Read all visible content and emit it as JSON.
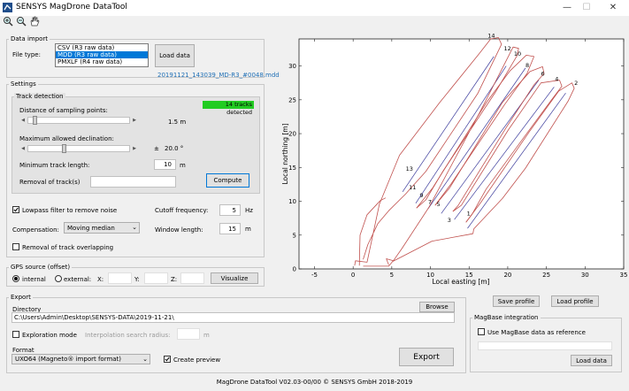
{
  "window": {
    "title": "SENSYS MagDrone DataTool",
    "minimize": "—",
    "maximize": "☐",
    "close": "✕"
  },
  "data_import": {
    "group_label": "Data import",
    "file_type_label": "File type:",
    "file_types": [
      "CSV (R3 raw data)",
      "MDD (R3 raw data)",
      "PMXLF (R4 raw data)"
    ],
    "selected_index": 1,
    "load_button": "Load data",
    "file_name": "20191121_143039_MD-R3_#0048.mdd"
  },
  "settings": {
    "group_label": "Settings",
    "track_detection": {
      "group_label": "Track detection",
      "badge": "14 tracks detected",
      "badge_color": "#22cc22",
      "sampling_label": "Distance of sampling points:",
      "sampling_value": "1.5 m",
      "sampling_level": 0.05,
      "declination_label": "Maximum allowed declination:",
      "declination_pm": "±",
      "declination_value": "20.0 °",
      "declination_level": 0.35,
      "min_length_label": "Minimum track length:",
      "min_length_value": "10",
      "min_length_unit": "m",
      "removal_label": "Removal of track(s)",
      "removal_value": "",
      "compute_button": "Compute"
    },
    "lowpass_label": "Lowpass filter to remove noise",
    "lowpass_checked": true,
    "cutoff_label": "Cutoff frequency:",
    "cutoff_value": "5",
    "cutoff_unit": "Hz",
    "compensation_label": "Compensation:",
    "compensation_value": "Moving median",
    "window_label": "Window length:",
    "window_value": "15",
    "window_unit": "m",
    "removal_overlap_label": "Removal of track overlapping",
    "removal_overlap_checked": false
  },
  "gps": {
    "group_label": "GPS source (offset)",
    "internal_label": "internal",
    "external_label": "external:",
    "x_label": "X:",
    "y_label": "Y:",
    "z_label": "Z:",
    "visualize_button": "Visualize"
  },
  "export": {
    "group_label": "Export",
    "directory_label": "Directory",
    "browse_button": "Browse",
    "directory_value": "C:\\Users\\Admin\\Desktop\\SENSYS-DATA\\2019-11-21\\",
    "exploration_label": "Exploration mode",
    "interp_label": "Interpolation search radius:",
    "interp_unit": "m",
    "format_label": "Format",
    "format_value": "UXO64 (Magneto® import format)",
    "create_preview_label": "Create preview",
    "create_preview_checked": true,
    "export_button": "Export"
  },
  "plot_buttons": {
    "save_profile": "Save profile",
    "load_profile": "Load profile"
  },
  "magbase": {
    "group_label": "MagBase integration",
    "use_label": "Use MagBase data as reference",
    "load_button": "Load data"
  },
  "status": "MagDrone DataTool V02.03-00/00 © SENSYS GmbH 2018-2019",
  "chart_data": {
    "type": "line",
    "xlabel": "Local easting [m]",
    "ylabel": "Local northing [m]",
    "xlim": [
      -7,
      35
    ],
    "ylim": [
      0,
      34
    ],
    "xticks": [
      -5,
      0,
      5,
      10,
      15,
      20,
      25,
      30,
      35
    ],
    "yticks": [
      0,
      5,
      10,
      15,
      20,
      25,
      30
    ],
    "track_color": "#c0504d",
    "center_color": "#3c3c9c",
    "track_labels": [
      {
        "text": "1",
        "x": 14.7,
        "y": 7.9
      },
      {
        "text": "2",
        "x": 28.6,
        "y": 27.2
      },
      {
        "text": "3",
        "x": 12.2,
        "y": 6.9
      },
      {
        "text": "4",
        "x": 26.1,
        "y": 27.8
      },
      {
        "text": "5",
        "x": 10.8,
        "y": 9.3
      },
      {
        "text": "6",
        "x": 24.3,
        "y": 28.6
      },
      {
        "text": "7",
        "x": 9.7,
        "y": 9.6
      },
      {
        "text": "8",
        "x": 22.3,
        "y": 29.8
      },
      {
        "text": "9",
        "x": 8.6,
        "y": 10.6
      },
      {
        "text": "10",
        "x": 20.8,
        "y": 31.5
      },
      {
        "text": "11",
        "x": 7.2,
        "y": 11.8
      },
      {
        "text": "12",
        "x": 19.5,
        "y": 32.3
      },
      {
        "text": "13",
        "x": 6.8,
        "y": 14.5
      },
      {
        "text": "14",
        "x": 17.4,
        "y": 34.2
      }
    ],
    "series": [
      {
        "values": [
          [
            0.2,
            0.5
          ],
          [
            0.3,
            1.2
          ],
          [
            1.8,
            1.0
          ],
          [
            3.4,
            9.6
          ],
          [
            6.0,
            16.8
          ],
          [
            11.2,
            24.6
          ],
          [
            16.3,
            31.8
          ],
          [
            17.8,
            34.0
          ],
          [
            18.8,
            34.2
          ],
          [
            19.2,
            33.2
          ],
          [
            16.1,
            25.9
          ],
          [
            9.4,
            14.4
          ],
          [
            6.8,
            11.1
          ],
          [
            4.6,
            8.6
          ],
          [
            3.2,
            6.7
          ],
          [
            1.9,
            3.6
          ],
          [
            1.3,
            1.4
          ]
        ]
      },
      {
        "values": [
          [
            4.6,
            0.6
          ],
          [
            4.3,
            1.5
          ],
          [
            5.2,
            1.2
          ],
          [
            6.3,
            3.0
          ],
          [
            9.8,
            9.1
          ],
          [
            16.5,
            23.4
          ],
          [
            19.4,
            29.9
          ],
          [
            20.7,
            32.8
          ],
          [
            21.4,
            32.6
          ],
          [
            21.2,
            31.5
          ],
          [
            18.4,
            26.1
          ],
          [
            11.6,
            14.4
          ],
          [
            9.4,
            10.2
          ],
          [
            8.2,
            9.0
          ]
        ]
      },
      {
        "values": [
          [
            8.2,
            9.0
          ],
          [
            10.3,
            12.0
          ],
          [
            17.3,
            24.7
          ],
          [
            20.3,
            29.3
          ],
          [
            22.4,
            31.6
          ],
          [
            23.4,
            31.4
          ],
          [
            22.5,
            28.9
          ],
          [
            19.6,
            24.3
          ],
          [
            12.7,
            12.6
          ],
          [
            10.6,
            9.4
          ]
        ]
      },
      {
        "values": [
          [
            10.6,
            9.4
          ],
          [
            12.5,
            12.0
          ],
          [
            19.3,
            24.6
          ],
          [
            22.9,
            29.2
          ],
          [
            24.5,
            29.9
          ],
          [
            24.7,
            28.9
          ],
          [
            23.4,
            27.2
          ],
          [
            19.8,
            20.9
          ],
          [
            13.6,
            9.4
          ],
          [
            12.9,
            8.5
          ]
        ]
      },
      {
        "values": [
          [
            12.9,
            8.5
          ],
          [
            14.0,
            9.4
          ],
          [
            20.1,
            20.6
          ],
          [
            24.3,
            27.5
          ],
          [
            26.7,
            27.9
          ],
          [
            27.0,
            27.0
          ],
          [
            25.6,
            24.9
          ],
          [
            21.8,
            19.0
          ],
          [
            17.2,
            11.8
          ],
          [
            15.4,
            8.1
          ],
          [
            14.6,
            6.9
          ]
        ]
      },
      {
        "values": [
          [
            14.6,
            6.9
          ],
          [
            16.5,
            9.8
          ],
          [
            22.8,
            20.3
          ],
          [
            26.6,
            26.3
          ],
          [
            28.3,
            27.5
          ],
          [
            28.6,
            26.7
          ],
          [
            27.8,
            24.8
          ],
          [
            22.3,
            14.9
          ],
          [
            19.3,
            10.4
          ],
          [
            16.5,
            7.0
          ],
          [
            15.6,
            5.9
          ],
          [
            15.5,
            5.2
          ]
        ]
      },
      {
        "values": [
          [
            1.3,
            0.4
          ],
          [
            4.6,
            0.4
          ],
          [
            5.1,
            1.1
          ],
          [
            10.2,
            4.1
          ],
          [
            15.5,
            5.2
          ]
        ]
      },
      {
        "values": [
          [
            0.8,
            0.5
          ],
          [
            0.9,
            5.0
          ],
          [
            1.8,
            8.0
          ],
          [
            3.5,
            10.1
          ],
          [
            4.2,
            10.5
          ]
        ]
      }
    ],
    "center_lines": [
      [
        [
          6.4,
          11.4
        ],
        [
          18.2,
          31.4
        ]
      ],
      [
        [
          8.1,
          9.7
        ],
        [
          19.8,
          30.0
        ]
      ],
      [
        [
          9.7,
          8.9
        ],
        [
          22.3,
          29.7
        ]
      ],
      [
        [
          11.4,
          8.2
        ],
        [
          24.0,
          27.9
        ]
      ],
      [
        [
          13.1,
          7.3
        ],
        [
          26.0,
          26.9
        ]
      ],
      [
        [
          14.8,
          6.0
        ],
        [
          27.5,
          26.0
        ]
      ]
    ]
  }
}
